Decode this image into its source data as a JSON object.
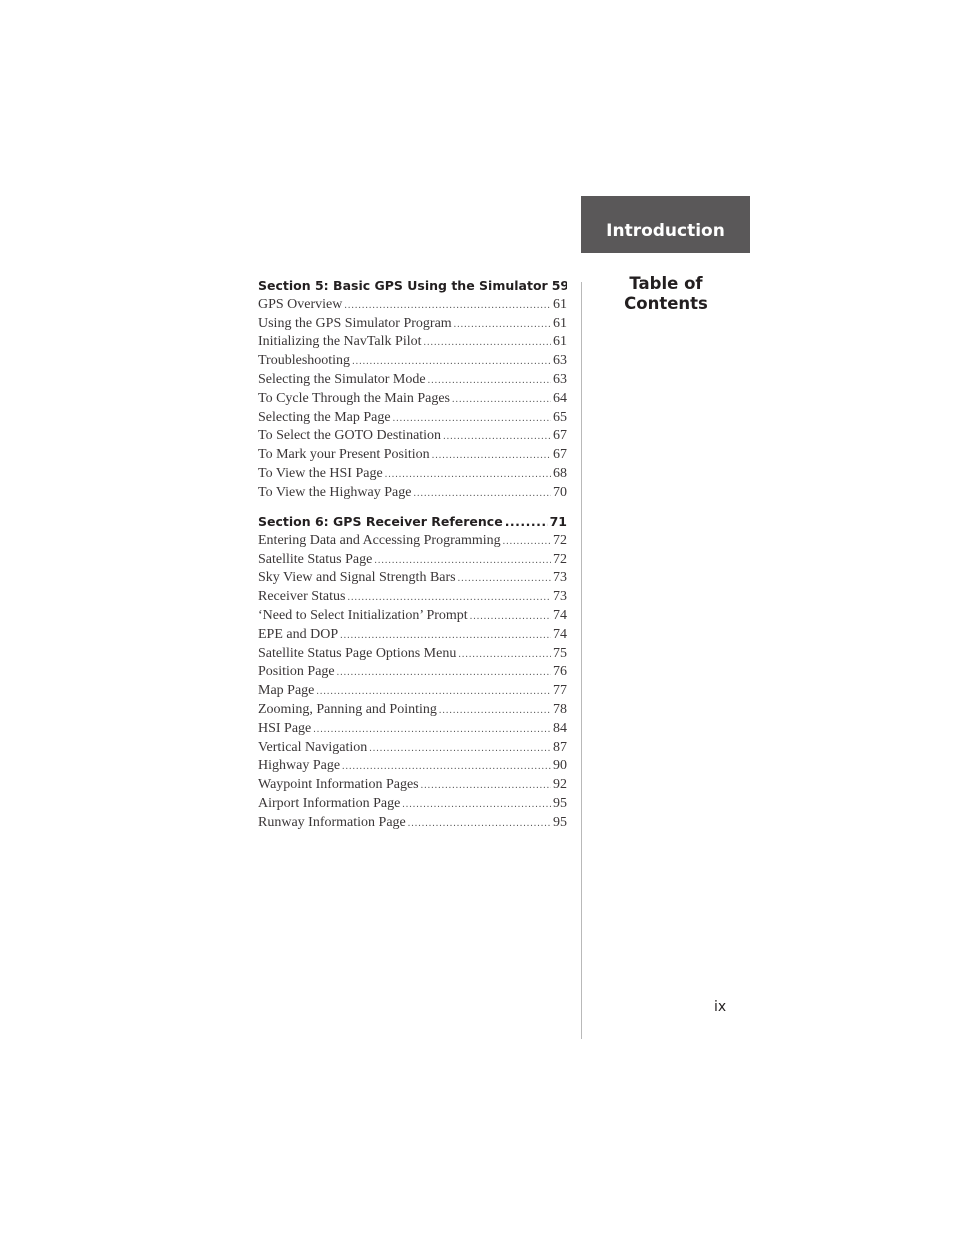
{
  "header": {
    "tab_label": "Introduction"
  },
  "sidebar": {
    "title_line1": "Table of",
    "title_line2": "Contents"
  },
  "footer": {
    "page_number": "ix"
  },
  "toc": {
    "sections": [
      {
        "title": "Section 5:  Basic GPS Using the Simulator",
        "page": "59",
        "entries": [
          {
            "label": "GPS Overview",
            "page": "61"
          },
          {
            "label": "Using the GPS Simulator Program",
            "page": "61"
          },
          {
            "label": "Initializing the NavTalk Pilot",
            "page": "61"
          },
          {
            "label": "Troubleshooting",
            "page": "63"
          },
          {
            "label": "Selecting the Simulator Mode",
            "page": "63"
          },
          {
            "label": "To Cycle Through the Main Pages",
            "page": "64"
          },
          {
            "label": "Selecting the Map Page",
            "page": "65"
          },
          {
            "label": "To Select the GOTO Destination",
            "page": "67"
          },
          {
            "label": "To Mark your Present Position",
            "page": "67"
          },
          {
            "label": "To View the HSI Page",
            "page": "68"
          },
          {
            "label": "To View the Highway Page",
            "page": "70"
          }
        ]
      },
      {
        "title": "Section 6:  GPS Receiver Reference",
        "page": "71",
        "entries": [
          {
            "label": "Entering Data and Accessing Programming",
            "page": "72"
          },
          {
            "label": "Satellite Status Page",
            "page": "72"
          },
          {
            "label": "Sky View and Signal Strength Bars",
            "page": "73"
          },
          {
            "label": "Receiver Status",
            "page": "73"
          },
          {
            "label": "‘Need to Select Initialization’ Prompt",
            "page": "74"
          },
          {
            "label": "EPE and DOP",
            "page": "74"
          },
          {
            "label": "Satellite Status Page Options Menu",
            "page": "75"
          },
          {
            "label": "Position Page",
            "page": "76"
          },
          {
            "label": "Map Page",
            "page": "77"
          },
          {
            "label": "Zooming, Panning and Pointing",
            "page": "78"
          },
          {
            "label": "HSI Page",
            "page": "84"
          },
          {
            "label": "Vertical Navigation",
            "page": "87"
          },
          {
            "label": "Highway Page",
            "page": "90"
          },
          {
            "label": "Waypoint Information Pages",
            "page": "92"
          },
          {
            "label": "Airport Information Page",
            "page": "95"
          },
          {
            "label": "Runway Information Page",
            "page": "95"
          }
        ]
      }
    ]
  }
}
